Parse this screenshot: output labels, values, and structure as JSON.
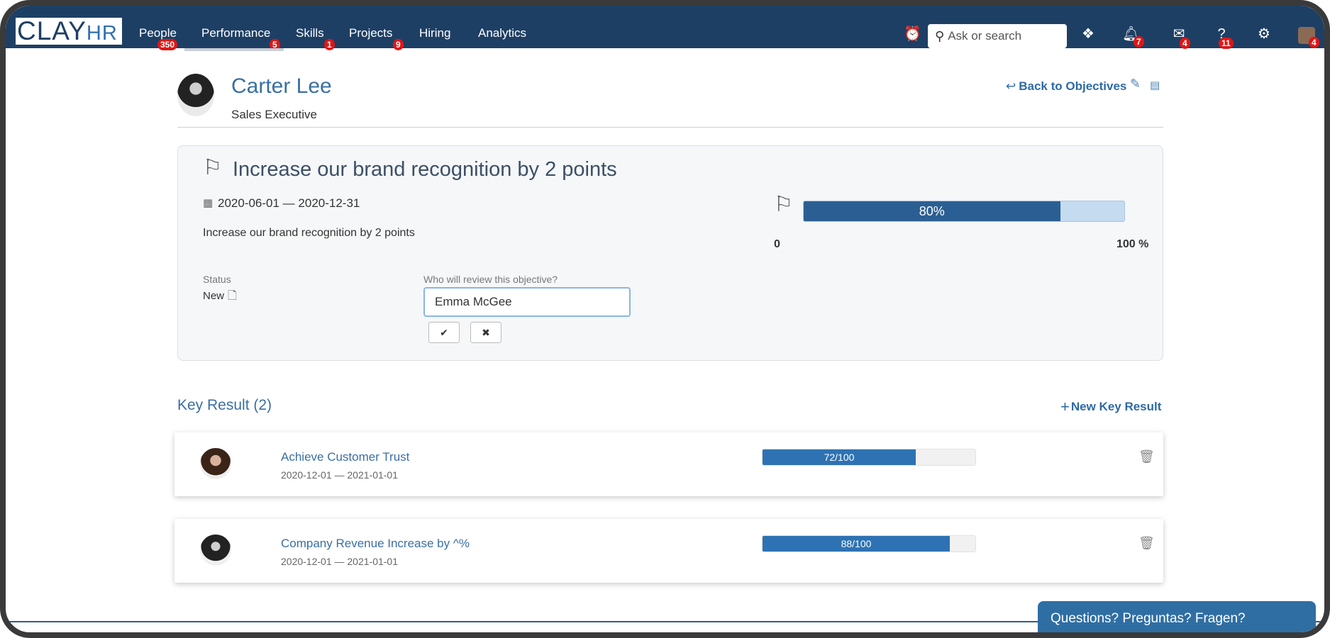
{
  "app": {
    "logo_main": "CLAY",
    "logo_sub": "HR"
  },
  "nav": {
    "items": [
      {
        "label": "People",
        "badge": "350"
      },
      {
        "label": "Performance",
        "badge": "5"
      },
      {
        "label": "Skills",
        "badge": "1"
      },
      {
        "label": "Projects",
        "badge": "9"
      },
      {
        "label": "Hiring",
        "badge": ""
      },
      {
        "label": "Analytics",
        "badge": ""
      }
    ],
    "search_placeholder": "Ask or search",
    "notifications_badge": "7",
    "messages_badge": "4",
    "help_badge": "11",
    "profile_badge": "4"
  },
  "employee": {
    "name": "Carter Lee",
    "title": "Sales Executive"
  },
  "header_actions": {
    "back_label": "Back to Objectives"
  },
  "objective": {
    "title": "Increase our brand recognition by 2 points",
    "dates": "2020-06-01 — 2020-12-31",
    "description": "Increase our brand recognition by 2 points",
    "status_label": "Status",
    "status_value": "New",
    "review_label": "Who will review this objective?",
    "review_value": "Emma McGee",
    "progress_percent": 80,
    "progress_label": "80%",
    "scale_min": "0",
    "scale_max": "100 %"
  },
  "key_results": {
    "heading": "Key Result (2)",
    "new_label": "New Key Result",
    "items": [
      {
        "title": "Achieve Customer Trust",
        "dates": "2020-12-01 — 2021-01-01",
        "value": 72,
        "label": "72/100"
      },
      {
        "title": "Company Revenue Increase by ^%",
        "dates": "2020-12-01 — 2021-01-01",
        "value": 88,
        "label": "88/100"
      }
    ]
  },
  "help_widget": {
    "label": "Questions? Preguntas? Fragen?"
  },
  "colors": {
    "nav_bg": "#1e3f64",
    "link_blue": "#3a6fa3",
    "progress_dark": "#2b5f93",
    "badge_red": "#e01616"
  }
}
